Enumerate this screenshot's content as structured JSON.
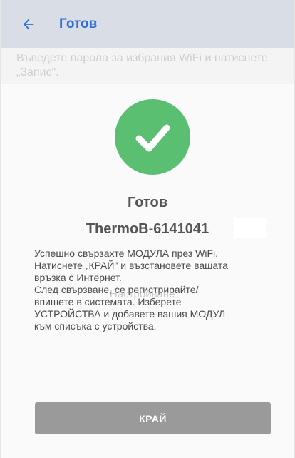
{
  "app_bar": {
    "title": "Готов",
    "back_icon": "arrow-left-icon"
  },
  "background_hint": "Въведете парола за избрания WiFi и натиснете „Запис\".",
  "status": {
    "icon": "checkmark-icon",
    "title": "Готов",
    "device_name": "ThermoB-6141041"
  },
  "message": {
    "line1": "Успешно свързахте МОДУЛА през WiFi.",
    "line2": "Натиснете „КРАЙ\" и възстановете вашата",
    "line3": "връзка с Интернет.",
    "line4": "След свързване, се регистрирайте/",
    "line5": "впишете в системата. Изберете",
    "line6": "УСТРОЙСТВА и добавете вашия МОДУЛ",
    "line7": "към списъка с устройства."
  },
  "ghost_label": "Настройване",
  "done_button": {
    "label": "КРАЙ"
  },
  "colors": {
    "accent": "#2f6fd6",
    "success": "#5bbf72",
    "button": "#9a9a9a"
  }
}
